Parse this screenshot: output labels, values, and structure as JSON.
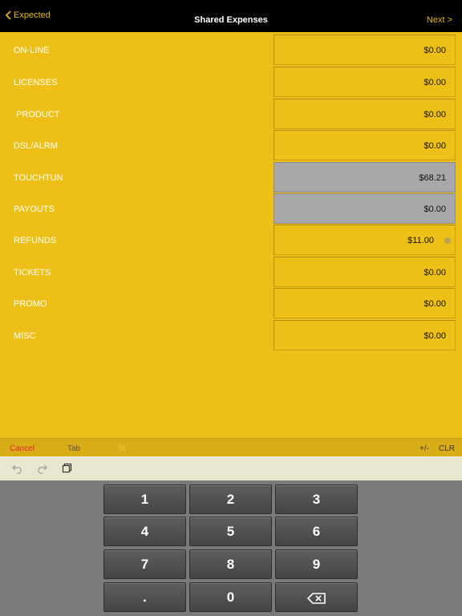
{
  "navbar": {
    "back_label": "Expected",
    "title": "Shared Expenses",
    "next_label": "Next >"
  },
  "rows": [
    {
      "label": "ON-LINE",
      "value": "$0.00"
    },
    {
      "label": "LICENSES",
      "value": "$0.00"
    },
    {
      "label": " PRODUCT",
      "value": "$0.00"
    },
    {
      "label": "DSL/ALRM",
      "value": "$0.00"
    },
    {
      "label": "TOUCHTUN",
      "value": "$68.21"
    },
    {
      "label": "PAYOUTS",
      "value": "$0.00"
    },
    {
      "label": "REFUNDS",
      "value": "$11.00"
    },
    {
      "label": "TICKETS",
      "value": "$0.00"
    },
    {
      "label": "PROMO",
      "value": "$0.00"
    },
    {
      "label": "MISC",
      "value": "$0.00"
    }
  ],
  "accessory": {
    "cancel": "Cancel",
    "tab": "Tab",
    "percent": "%",
    "plus_minus": "+/-",
    "clear": "CLR"
  },
  "toolbar_icons": [
    "undo-icon",
    "redo-icon",
    "paste-icon"
  ],
  "keypad": {
    "keys": [
      "1",
      "2",
      "3",
      "4",
      "5",
      "6",
      "7",
      "8",
      "9",
      ".",
      "0"
    ],
    "backspace_icon": "backspace-icon"
  },
  "colors": {
    "background": "#eec017",
    "navbar": "#000000",
    "nav_accent": "#e8b818",
    "readonly_field": "#a8a8a8",
    "cancel": "#e2262a",
    "keypad_bg": "#7a7a7a"
  }
}
